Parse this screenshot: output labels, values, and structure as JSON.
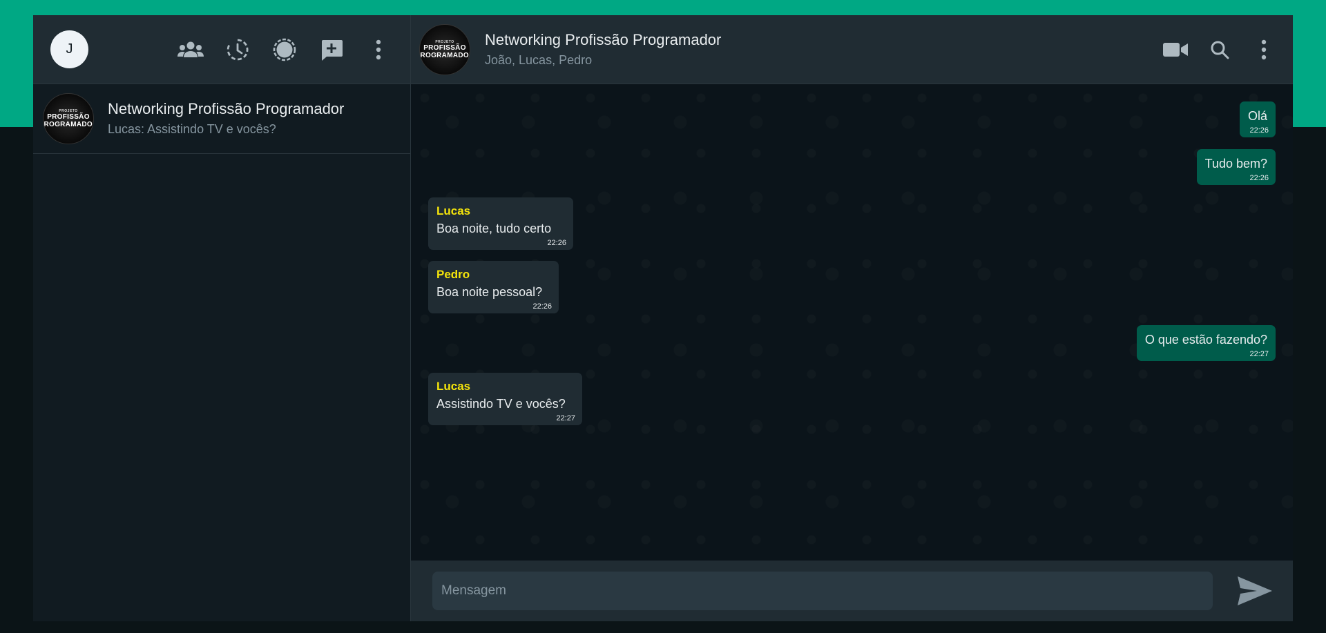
{
  "user": {
    "avatar_initial": "J"
  },
  "sidebar": {
    "chats": [
      {
        "name": "Networking Profissão Programador",
        "last_message": "Lucas: Assistindo TV e vocês?",
        "avatar": {
          "small": "PROJETO",
          "line1": "PROFISSÃO",
          "line2": "PROGRAMADOR"
        }
      }
    ]
  },
  "chat": {
    "title": "Networking Profissão Programador",
    "members": "João, Lucas, Pedro",
    "avatar": {
      "small": "PROJETO",
      "line1": "PROFISSÃO",
      "line2": "PROGRAMADOR"
    },
    "messages": [
      {
        "direction": "out",
        "sender": "",
        "text": "Olá",
        "time": "22:26"
      },
      {
        "direction": "out",
        "sender": "",
        "text": "Tudo bem?",
        "time": "22:26"
      },
      {
        "direction": "in",
        "sender": "Lucas",
        "text": "Boa noite, tudo certo",
        "time": "22:26"
      },
      {
        "direction": "in",
        "sender": "Pedro",
        "text": "Boa noite pessoal?",
        "time": "22:26"
      },
      {
        "direction": "out",
        "sender": "",
        "text": "O que estão fazendo?",
        "time": "22:27"
      },
      {
        "direction": "in",
        "sender": "Lucas",
        "text": "Assistindo TV e vocês?",
        "time": "22:27"
      }
    ]
  },
  "composer": {
    "placeholder": "Mensagem"
  },
  "colors": {
    "accent": "#00a884",
    "outgoing_bubble": "#005c4b",
    "incoming_bubble": "#202c33",
    "sender_name": "#f5e50b",
    "panel": "#202c33",
    "background": "#111b21"
  },
  "icons": {
    "sidebar": [
      "communities-icon",
      "status-icon",
      "channels-icon",
      "new-chat-icon",
      "menu-icon"
    ],
    "chat_header": [
      "video-call-icon",
      "search-icon",
      "menu-icon"
    ],
    "composer": [
      "send-icon"
    ]
  }
}
